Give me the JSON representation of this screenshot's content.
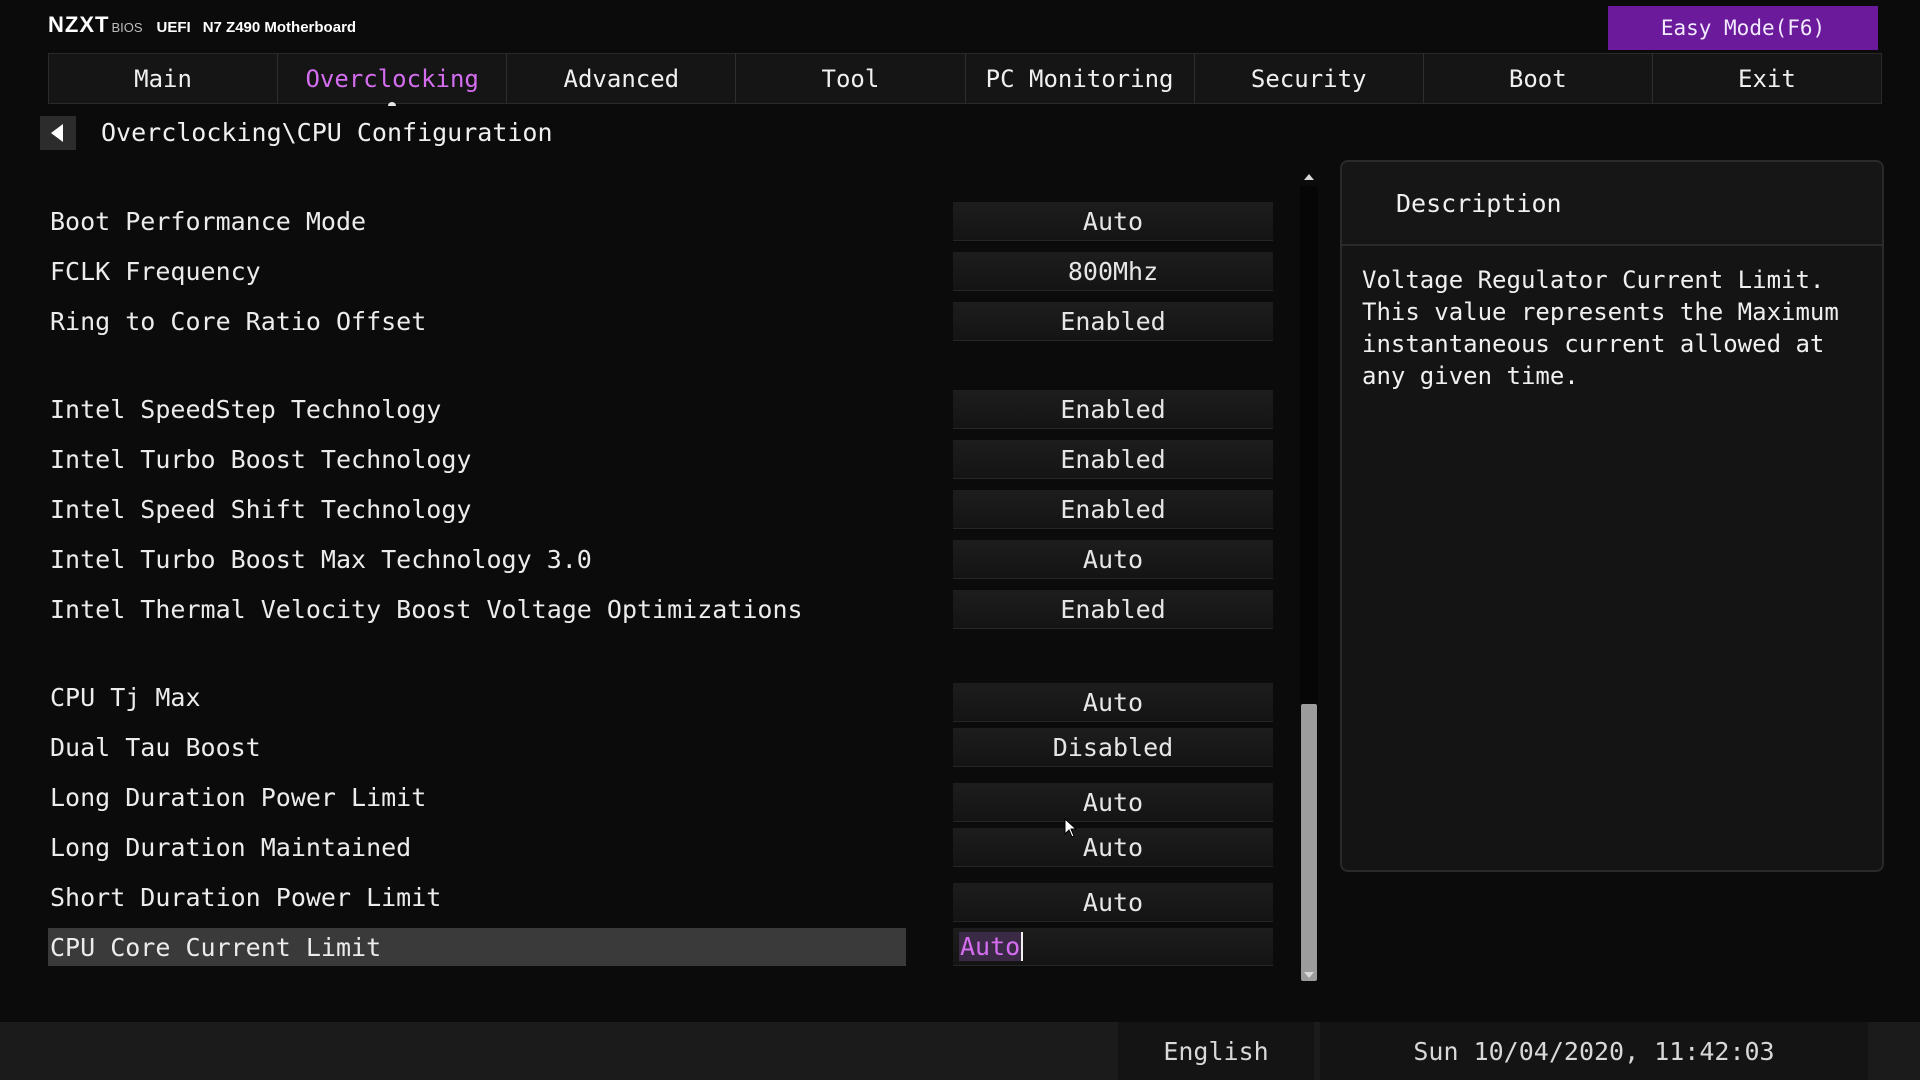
{
  "header": {
    "logo": "NZXT",
    "bios": "BIOS",
    "uefi": "UEFI",
    "board": "N7 Z490 Motherboard",
    "easy_mode": "Easy Mode(F6)"
  },
  "tabs": [
    {
      "label": "Main",
      "active": false
    },
    {
      "label": "Overclocking",
      "active": true
    },
    {
      "label": "Advanced",
      "active": false
    },
    {
      "label": "Tool",
      "active": false
    },
    {
      "label": "PC Monitoring",
      "active": false
    },
    {
      "label": "Security",
      "active": false
    },
    {
      "label": "Boot",
      "active": false
    },
    {
      "label": "Exit",
      "active": false
    }
  ],
  "breadcrumb": "Overclocking\\CPU Configuration",
  "settings": [
    {
      "label": "Boot Performance Mode",
      "value": "Auto"
    },
    {
      "label": "FCLK Frequency",
      "value": "800Mhz"
    },
    {
      "label": "Ring to Core Ratio Offset",
      "value": "Enabled"
    },
    {
      "label": "Intel SpeedStep Technology",
      "value": "Enabled"
    },
    {
      "label": "Intel Turbo Boost Technology",
      "value": "Enabled"
    },
    {
      "label": "Intel Speed Shift Technology",
      "value": "Enabled"
    },
    {
      "label": "Intel Turbo Boost Max Technology 3.0",
      "value": "Auto"
    },
    {
      "label": "Intel Thermal Velocity Boost Voltage Optimizations",
      "value": "Enabled"
    },
    {
      "label": "CPU Tj Max",
      "value": "Auto"
    },
    {
      "label": "Dual Tau Boost",
      "value": "Disabled"
    },
    {
      "label": "Long Duration Power Limit",
      "value": "Auto"
    },
    {
      "label": "Long Duration Maintained",
      "value": "Auto"
    },
    {
      "label": "Short Duration Power Limit",
      "value": "Auto"
    },
    {
      "label": "CPU Core Current Limit",
      "value": "Auto"
    }
  ],
  "description": {
    "title": "Description",
    "text": "Voltage Regulator Current Limit. This value represents the Maximum instantaneous current allowed at any given time."
  },
  "footer": {
    "language": "English",
    "datetime": "Sun 10/04/2020, 11:42:03"
  },
  "colors": {
    "accent": "#d56df0",
    "easy_mode_bg": "#6a1a9a"
  }
}
